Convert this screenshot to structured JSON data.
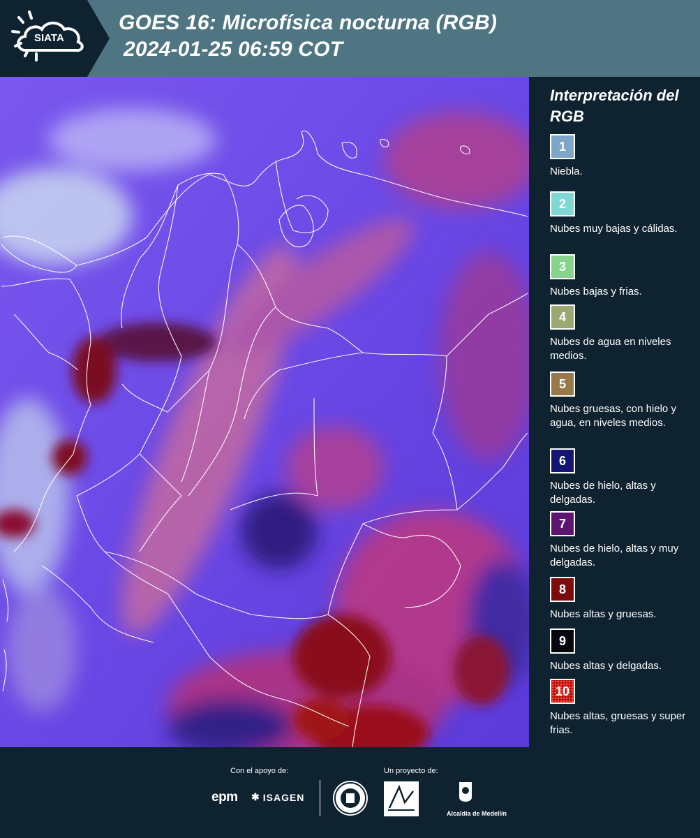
{
  "header": {
    "logo_text": "SIATA",
    "title_line1": "GOES 16: Microfísica nocturna (RGB)",
    "title_line2": "2024-01-25 06:59 COT"
  },
  "legend": {
    "title": "Interpretación del RGB",
    "items": [
      {
        "num": "1",
        "label": "Niebla.",
        "color": "#7ea6c9"
      },
      {
        "num": "2",
        "label": "Nubes muy bajas y cálidas.",
        "color": "#7fd8d4"
      },
      {
        "num": "3",
        "label": "Nubes bajas y frias.",
        "color": "#86d48c"
      },
      {
        "num": "4",
        "label": "Nubes de agua en niveles medios.",
        "color": "#9aa872"
      },
      {
        "num": "5",
        "label": "Nubes gruesas, con hielo y agua, en niveles medios.",
        "color": "#97794b"
      },
      {
        "num": "6",
        "label": "Nubes de hielo, altas y delgadas.",
        "color": "#141472"
      },
      {
        "num": "7",
        "label": "Nubes de hielo, altas y muy delgadas.",
        "color": "#5c1470"
      },
      {
        "num": "8",
        "label": "Nubes altas y gruesas.",
        "color": "#7d0b0b"
      },
      {
        "num": "9",
        "label": "Nubes altas y delgadas.",
        "color": "#06060f"
      },
      {
        "num": "10",
        "label": "Nubes altas, gruesas y super frias.",
        "color": "#b81010"
      }
    ]
  },
  "footer": {
    "support_label": "Con el apoyo de:",
    "project_label": "Un proyecto de:",
    "sponsor1": "epm",
    "sponsor2": "ISAGEN",
    "partner3": "Alcaldía de Medellín"
  },
  "colors": {
    "header_bg": "#4f7583",
    "page_bg": "#0e2230",
    "map_base": "#6b45e8"
  }
}
